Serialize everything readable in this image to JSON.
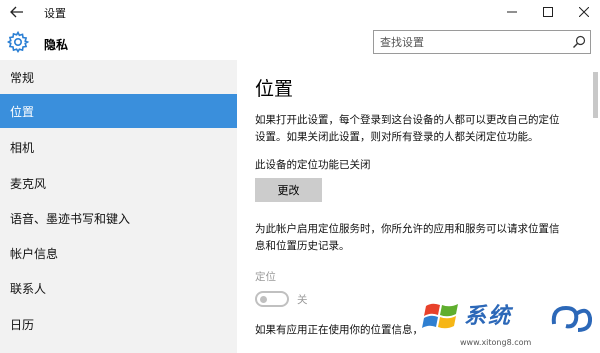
{
  "window": {
    "title": "设置"
  },
  "header": {
    "title": "隐私",
    "search_placeholder": "查找设置"
  },
  "sidebar": {
    "items": [
      {
        "label": "常规",
        "selected": false
      },
      {
        "label": "位置",
        "selected": true
      },
      {
        "label": "相机",
        "selected": false
      },
      {
        "label": "麦克风",
        "selected": false
      },
      {
        "label": "语音、墨迹书写和键入",
        "selected": false
      },
      {
        "label": "帐户信息",
        "selected": false
      },
      {
        "label": "联系人",
        "selected": false
      },
      {
        "label": "日历",
        "selected": false
      }
    ]
  },
  "main": {
    "title": "位置",
    "description_line1": "如果打开此设置，每个登录到这台设备的人都可以更改自己的定位",
    "description_line2": "设置。如果关闭此设置，则对所有登录的人都关闭定位功能。",
    "device_status": "此设备的定位功能已关闭",
    "change_button": "更改",
    "service_desc_line1": "为此帐户启用定位服务时，你所允许的应用和服务可以请求位置信",
    "service_desc_line2": "息和位置历史记录。",
    "location_label": "定位",
    "toggle_state": "关",
    "toggle_on": false,
    "bottom_text": "如果有应用正在使用你的位置信息，"
  },
  "watermark": {
    "brand_text": "系统",
    "url": "www.xitong8.com"
  },
  "colors": {
    "selected_bg": "#3a8fdc",
    "sidebar_bg": "#f2f2f2",
    "button_bg": "#cccccc"
  },
  "icons": {
    "back": "arrow-left-icon",
    "minimize": "minimize-icon",
    "maximize": "maximize-icon",
    "close": "close-icon",
    "privacy": "gear-icon",
    "search": "search-icon"
  }
}
